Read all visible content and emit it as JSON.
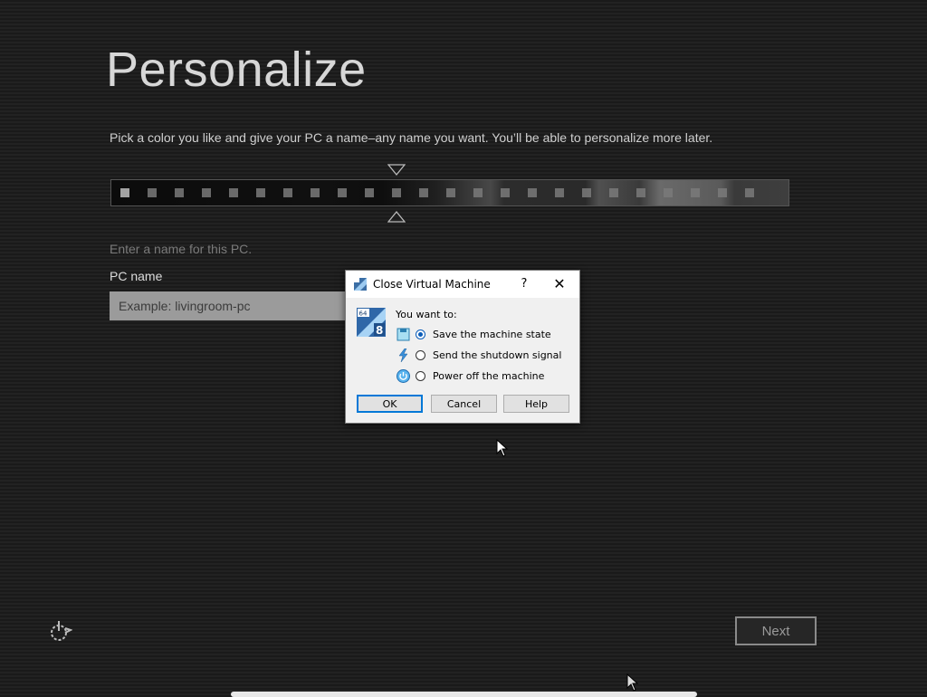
{
  "setup": {
    "title": "Personalize",
    "subtitle": "Pick a color you like and give your PC a name–any name you want. You’ll be able to personalize more later.",
    "name_hint": "Enter a name for this PC.",
    "pc_name_label": "PC name",
    "pc_name_placeholder": "Example: livingroom-pc",
    "pc_name_value": "",
    "next_label": "Next"
  },
  "dialog": {
    "title": "Close Virtual Machine",
    "help_glyph": "?",
    "close_glyph": "✕",
    "prompt": "You want to:",
    "options": [
      {
        "label": "Save the machine state",
        "icon": "save-state-icon",
        "checked": true
      },
      {
        "label": "Send the shutdown signal",
        "icon": "shutdown-signal-icon",
        "checked": false
      },
      {
        "label": "Power off the machine",
        "icon": "power-off-icon",
        "checked": false
      }
    ],
    "buttons": {
      "ok": "OK",
      "cancel": "Cancel",
      "help": "Help"
    }
  },
  "colors": {
    "accent_blue": "#0a5cb8",
    "dialog_bg": "#f0f0f0",
    "page_bg": "#1c1c1c"
  }
}
